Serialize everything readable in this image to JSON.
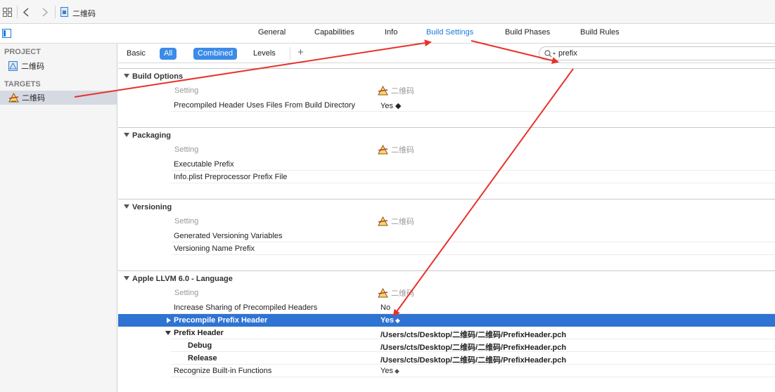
{
  "breadcrumb": {
    "file_name": "二维码"
  },
  "tabs": [
    {
      "label": "General"
    },
    {
      "label": "Capabilities"
    },
    {
      "label": "Info"
    },
    {
      "label": "Build Settings",
      "active": true
    },
    {
      "label": "Build Phases"
    },
    {
      "label": "Build Rules"
    }
  ],
  "sidebar": {
    "project_header": "PROJECT",
    "project_item": "二维码",
    "targets_header": "TARGETS",
    "target_item": "二维码"
  },
  "filters": {
    "basic": "Basic",
    "all": "All",
    "combined": "Combined",
    "levels": "Levels",
    "add": "+"
  },
  "search": {
    "value": "prefix",
    "icon": "magnifier-icon"
  },
  "sections": [
    {
      "title": "Build Options",
      "setting_header": "Setting",
      "target_header": "二维码",
      "rows": [
        {
          "name": "Precompiled Header Uses Files From Build Directory",
          "value": "Yes ◆"
        }
      ]
    },
    {
      "title": "Packaging",
      "setting_header": "Setting",
      "target_header": "二维码",
      "rows": [
        {
          "name": "Executable Prefix",
          "value": ""
        },
        {
          "name": "Info.plist Preprocessor Prefix File",
          "value": ""
        }
      ]
    },
    {
      "title": "Versioning",
      "setting_header": "Setting",
      "target_header": "二维码",
      "rows": [
        {
          "name": "Generated Versioning Variables",
          "value": ""
        },
        {
          "name": "Versioning Name Prefix",
          "value": ""
        }
      ]
    },
    {
      "title": "Apple LLVM 6.0 - Language",
      "setting_header": "Setting",
      "target_header": "二维码",
      "rows": [
        {
          "name": "Increase Sharing of Precompiled Headers",
          "value": "No"
        },
        {
          "name": "Precompile Prefix Header",
          "value": "Yes",
          "selected": true
        },
        {
          "name": "Prefix Header",
          "value": "/Users/cts/Desktop/二维码/二维码/PrefixHeader.pch"
        },
        {
          "name": "Debug",
          "value": "/Users/cts/Desktop/二维码/二维码/PrefixHeader.pch"
        },
        {
          "name": "Release",
          "value": "/Users/cts/Desktop/二维码/二维码/PrefixHeader.pch"
        },
        {
          "name": "Recognize Built-in Functions",
          "value": "Yes"
        }
      ]
    }
  ],
  "colors": {
    "accent": "#1a7ae0",
    "selection": "#2f73d3",
    "arrow": "#e8312a"
  }
}
